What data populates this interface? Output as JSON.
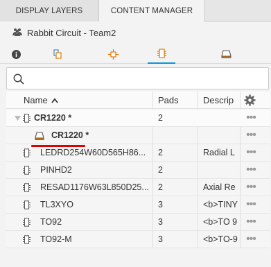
{
  "tabs": {
    "display_layers": "DISPLAY LAYERS",
    "content_manager": "CONTENT MANAGER"
  },
  "header": {
    "title": "Rabbit Circuit - Team2"
  },
  "search": {
    "placeholder": "",
    "value": ""
  },
  "table": {
    "columns": {
      "name": "Name",
      "pads": "Pads",
      "description": "Descrip"
    },
    "more_glyph": "•••",
    "rows": [
      {
        "name": "CR1220 *",
        "pads": "2",
        "desc": ""
      },
      {
        "name": "CR1220 *",
        "pads": "",
        "desc": ""
      },
      {
        "name": "LEDRD254W60D565H86...",
        "pads": "2",
        "desc": "Radial L"
      },
      {
        "name": "PINHD2",
        "pads": "2",
        "desc": ""
      },
      {
        "name": "RESAD1176W63L850D25...",
        "pads": "2",
        "desc": "Axial Re"
      },
      {
        "name": "TL3XYO",
        "pads": "3",
        "desc": "<b>TINY"
      },
      {
        "name": "TO92",
        "pads": "3",
        "desc": "<b>TO 9"
      },
      {
        "name": "TO92-M",
        "pads": "3",
        "desc": "<b>TO-9"
      }
    ]
  },
  "colors": {
    "accent": "#0696d7",
    "highlight": "#e00000",
    "package_icon": "#e07a00"
  }
}
